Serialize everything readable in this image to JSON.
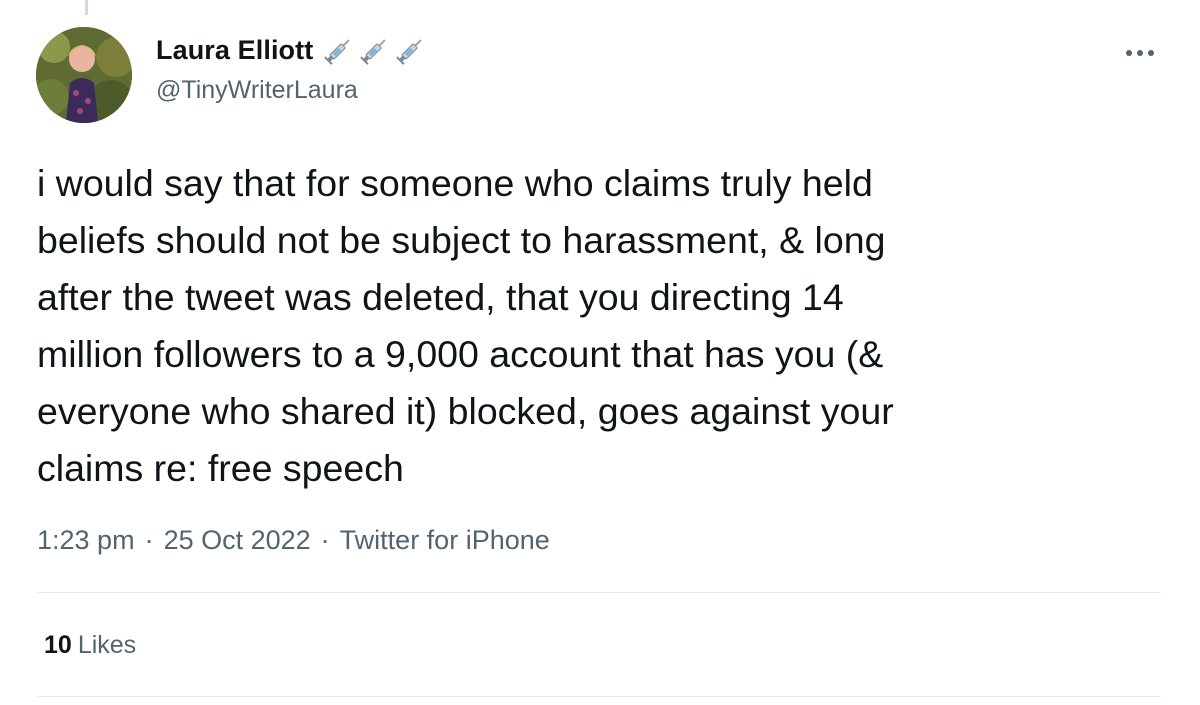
{
  "tweet": {
    "display_name": "Laura Elliott",
    "name_emojis": [
      "syringe-icon",
      "syringe-icon",
      "syringe-icon"
    ],
    "handle": "@TinyWriterLaura",
    "text": "i would say that for someone who claims truly held\nbeliefs should not be subject to harassment, & long\nafter the tweet was deleted, that you directing 14\nmillion followers to a 9,000 account that has you (&\neveryone who shared it) blocked, goes against your\nclaims re: free speech",
    "time": "1:23 pm",
    "date": "25 Oct 2022",
    "source": "Twitter for iPhone",
    "separator": "·",
    "likes_count": "10",
    "likes_label": "Likes"
  },
  "colors": {
    "text_primary": "#0f1419",
    "text_secondary": "#536471",
    "divider": "#e6ecf0"
  }
}
